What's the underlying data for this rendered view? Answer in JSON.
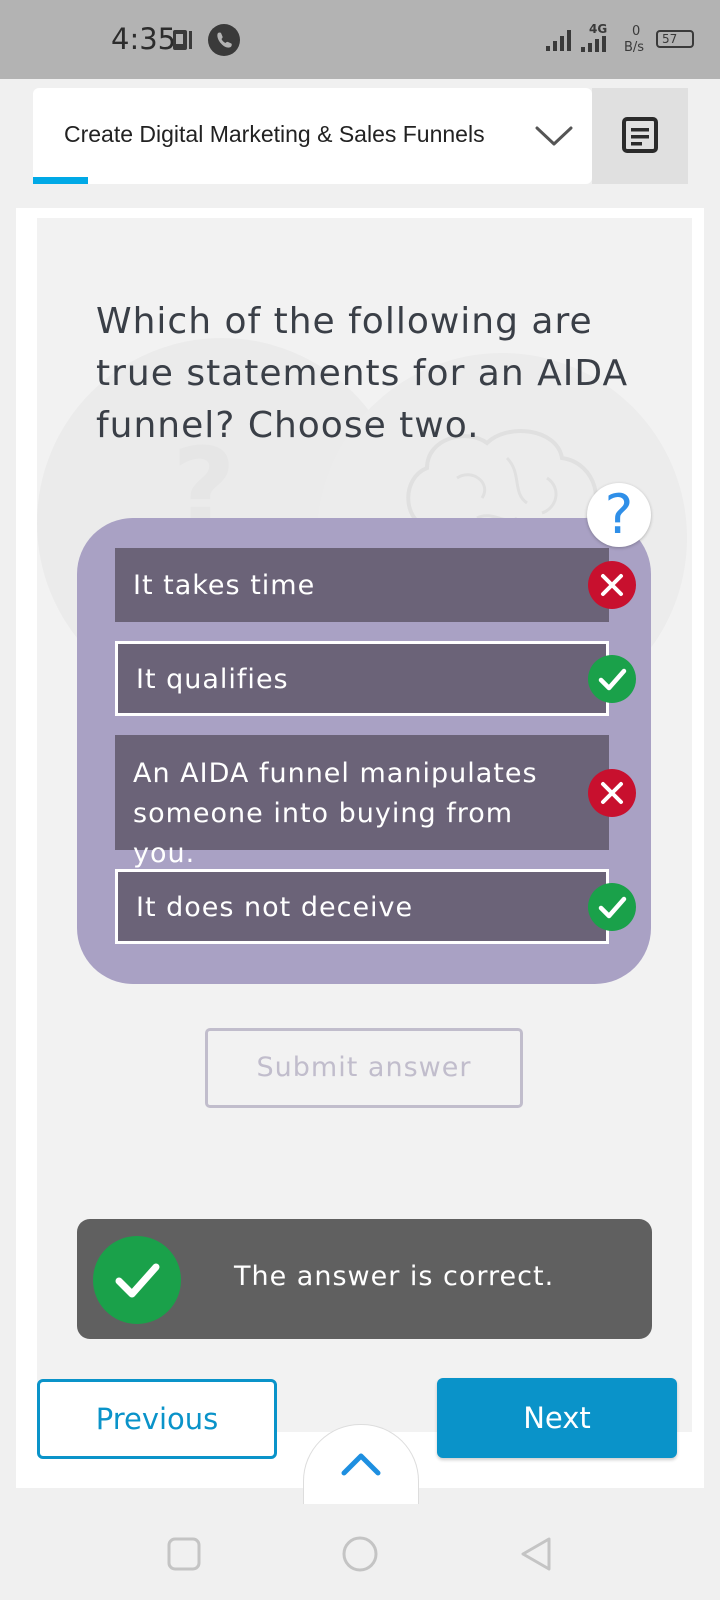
{
  "status_bar": {
    "time": "4:35",
    "network": "4G",
    "speed_value": "0",
    "speed_unit": "B/s",
    "battery": "57"
  },
  "header": {
    "course_title": "Create Digital Marketing & Sales Funnels",
    "tab_progress_color": "#00a9e6"
  },
  "quiz": {
    "question": "Which of the following are true statements for an AIDA funnel? Choose two.",
    "help_symbol": "?",
    "answers": [
      {
        "label": "It takes time",
        "selected": false,
        "result": "incorrect"
      },
      {
        "label": "It qualifies",
        "selected": true,
        "result": "correct"
      },
      {
        "label": "An AIDA funnel manipulates someone into buying from you.",
        "selected": false,
        "result": "incorrect"
      },
      {
        "label": "It does not deceive",
        "selected": true,
        "result": "correct"
      }
    ],
    "submit_label": "Submit answer",
    "feedback": "The answer is correct."
  },
  "navigation": {
    "previous_label": "Previous",
    "next_label": "Next"
  },
  "colors": {
    "accent": "#0a93c9",
    "correct": "#1aa14a",
    "incorrect": "#c8102e",
    "answer_panel": "#a9a1c4",
    "answer_bg": "#6b6378"
  },
  "icons": {
    "header_menu": "notes-icon",
    "scroll_up": "chevron-up-icon",
    "nav": [
      "square-icon",
      "circle-icon",
      "triangle-back-icon"
    ]
  }
}
